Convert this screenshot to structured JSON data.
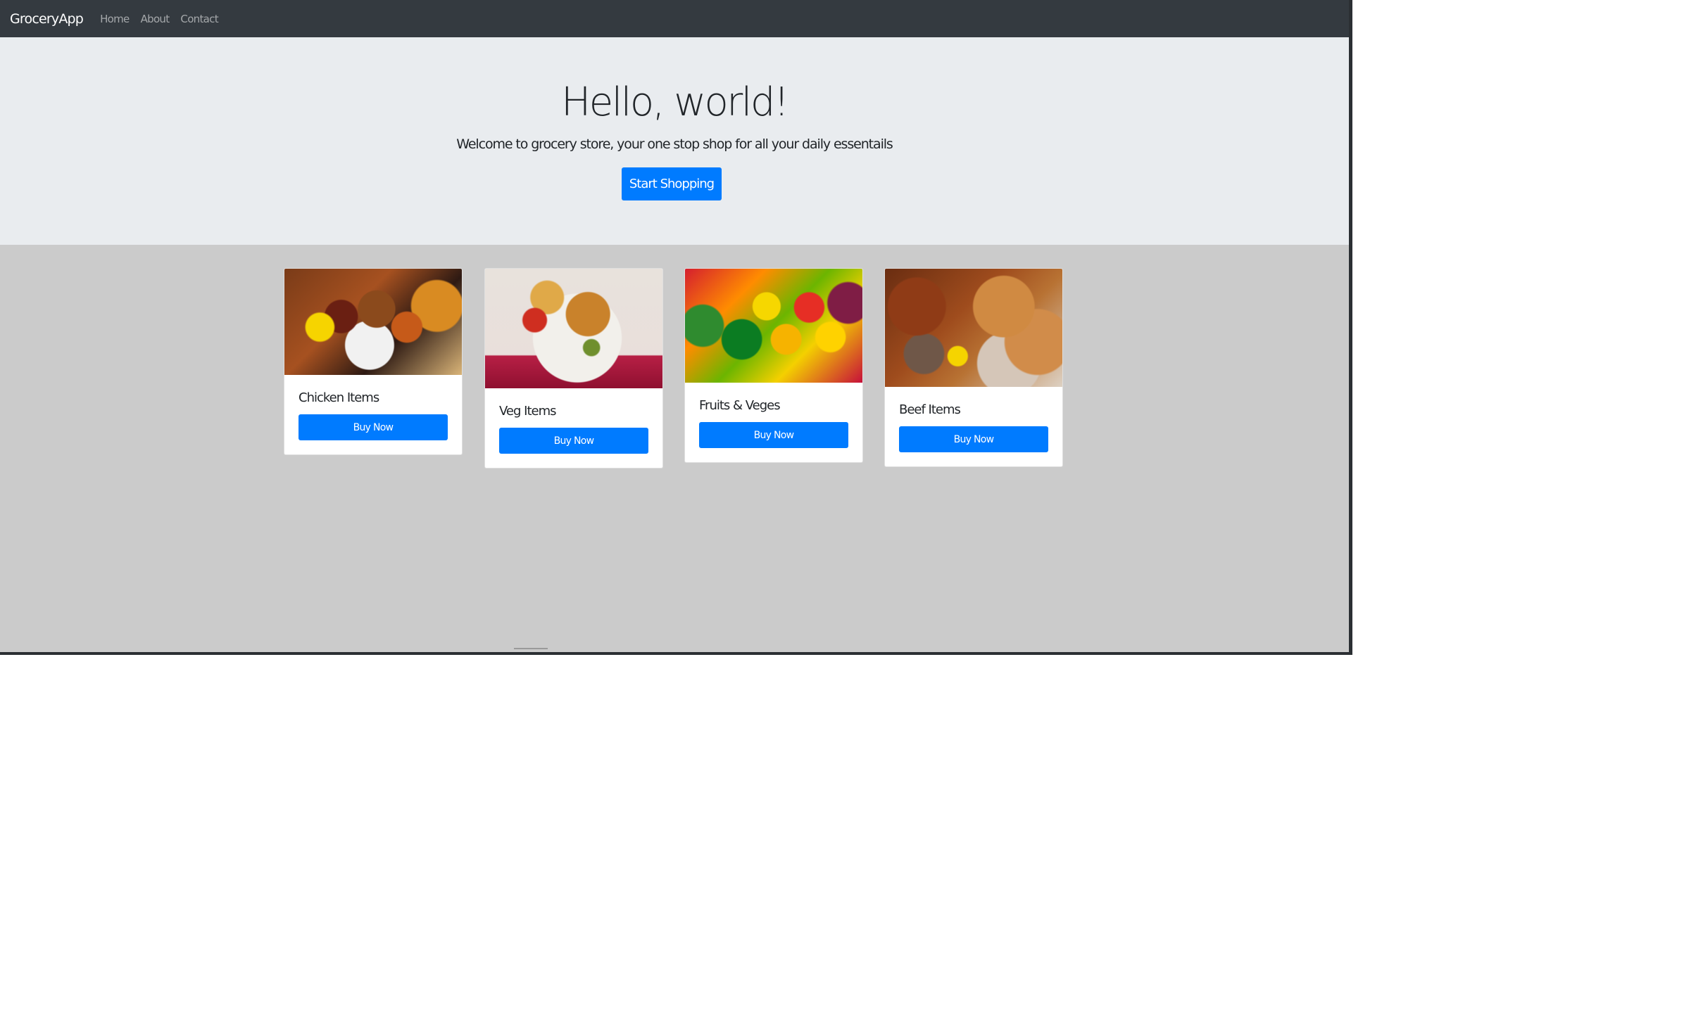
{
  "navbar": {
    "brand": "GroceryApp",
    "links": [
      "Home",
      "About",
      "Contact"
    ]
  },
  "hero": {
    "title": "Hello, world!",
    "lead": "Welcome to grocery store, your one stop shop for all your daily essentails",
    "button": "Start Shopping"
  },
  "cards": [
    {
      "title": "Chicken Items",
      "button": "Buy Now"
    },
    {
      "title": "Veg Items",
      "button": "Buy Now"
    },
    {
      "title": "Fruits & Veges",
      "button": "Buy Now"
    },
    {
      "title": "Beef Items",
      "button": "Buy Now"
    }
  ],
  "colors": {
    "navbar": "#343a40",
    "primary": "#007bff",
    "hero_background": "#e9ecef",
    "content_background": "#cbcbcb"
  }
}
